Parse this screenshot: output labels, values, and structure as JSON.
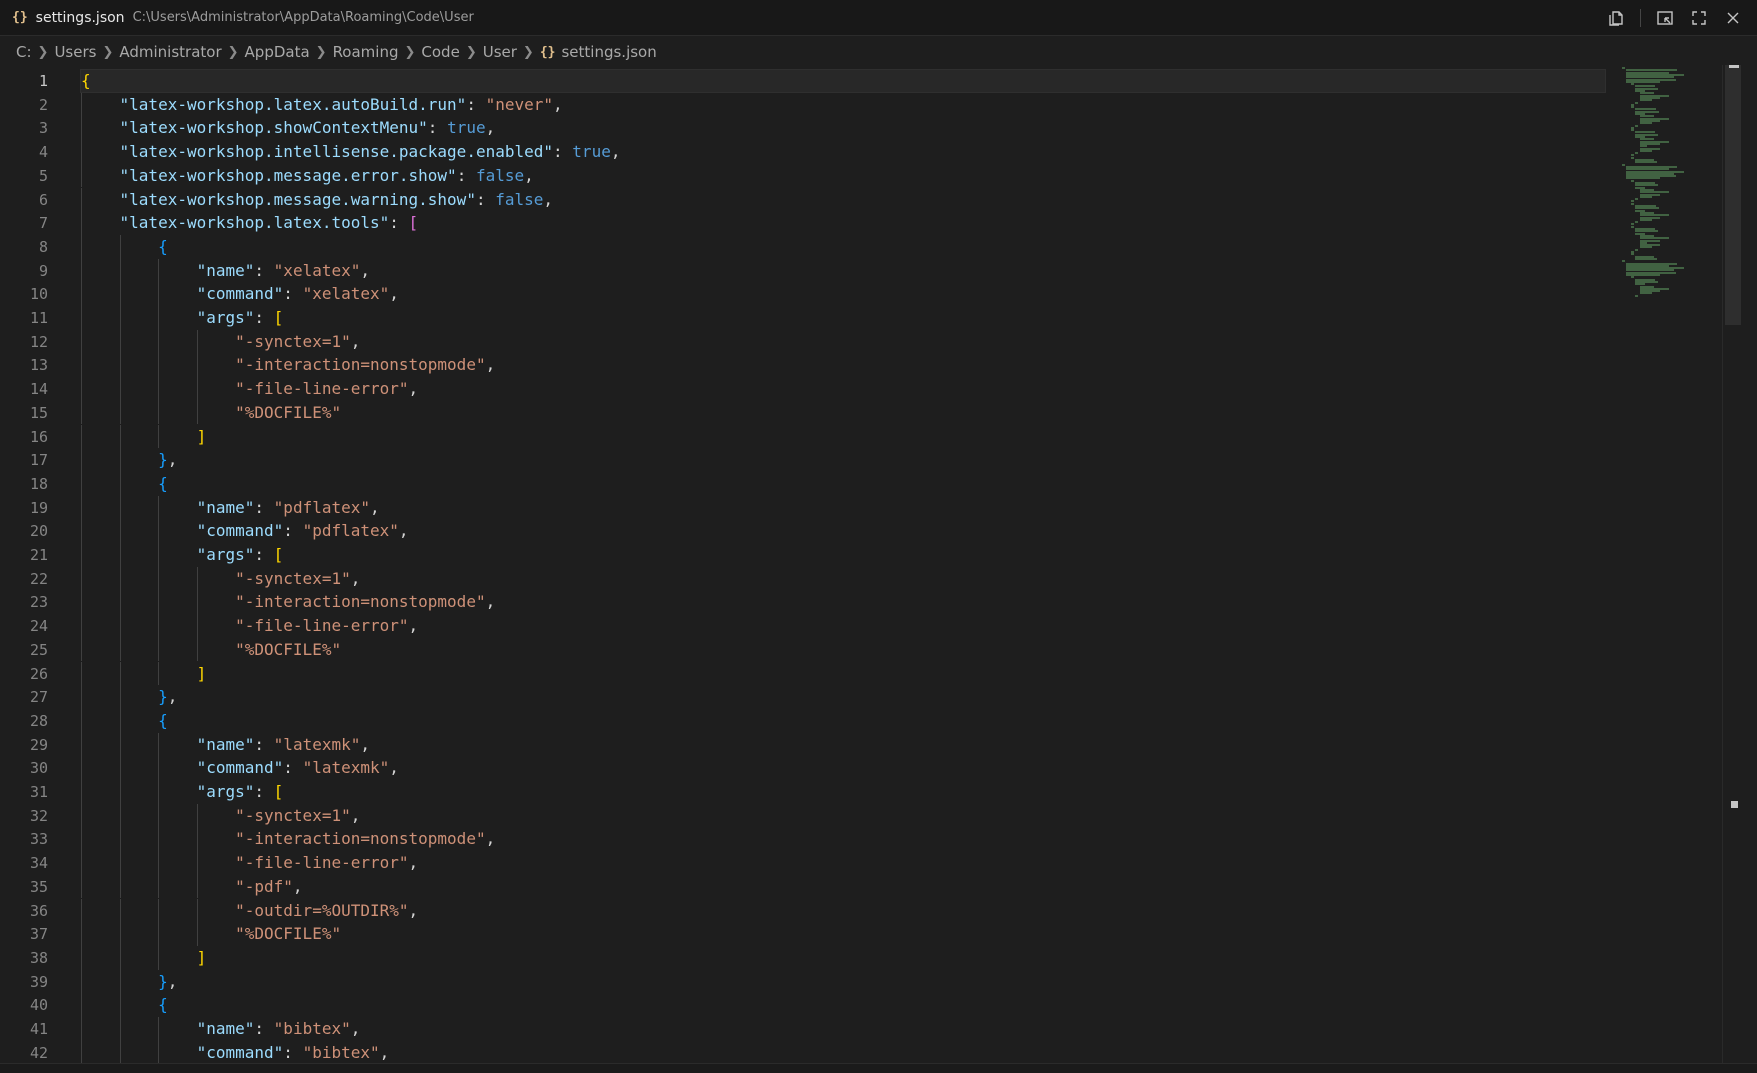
{
  "titlebar": {
    "file_icon": "{}",
    "filename": "settings.json",
    "path": "C:\\Users\\Administrator\\AppData\\Roaming\\Code\\User",
    "action_icons": [
      "copy-path-icon",
      "open-changes-icon",
      "maximize-icon",
      "close-icon"
    ]
  },
  "breadcrumb": {
    "segments": [
      "C:",
      "Users",
      "Administrator",
      "AppData",
      "Roaming",
      "Code",
      "User"
    ],
    "file_icon": "{}",
    "file": "settings.json"
  },
  "editor": {
    "active_line": 1,
    "lines": [
      "{",
      "    \"latex-workshop.latex.autoBuild.run\": \"never\",",
      "    \"latex-workshop.showContextMenu\": true,",
      "    \"latex-workshop.intellisense.package.enabled\": true,",
      "    \"latex-workshop.message.error.show\": false,",
      "    \"latex-workshop.message.warning.show\": false,",
      "    \"latex-workshop.latex.tools\": [",
      "        {",
      "            \"name\": \"xelatex\",",
      "            \"command\": \"xelatex\",",
      "            \"args\": [",
      "                \"-synctex=1\",",
      "                \"-interaction=nonstopmode\",",
      "                \"-file-line-error\",",
      "                \"%DOCFILE%\"",
      "            ]",
      "        },",
      "        {",
      "            \"name\": \"pdflatex\",",
      "            \"command\": \"pdflatex\",",
      "            \"args\": [",
      "                \"-synctex=1\",",
      "                \"-interaction=nonstopmode\",",
      "                \"-file-line-error\",",
      "                \"%DOCFILE%\"",
      "            ]",
      "        },",
      "        {",
      "            \"name\": \"latexmk\",",
      "            \"command\": \"latexmk\",",
      "            \"args\": [",
      "                \"-synctex=1\",",
      "                \"-interaction=nonstopmode\",",
      "                \"-file-line-error\",",
      "                \"-pdf\",",
      "                \"-outdir=%OUTDIR%\",",
      "                \"%DOCFILE%\"",
      "            ]",
      "        },",
      "        {",
      "            \"name\": \"bibtex\",",
      "            \"command\": \"bibtex\","
    ]
  },
  "colors": {
    "background": "#1e1e1e",
    "key": "#9cdcfe",
    "string": "#ce9178",
    "keyword": "#569cd6",
    "bracket_level1": "#ffd700",
    "bracket_level2": "#da70d6",
    "bracket_level3": "#179fff"
  }
}
